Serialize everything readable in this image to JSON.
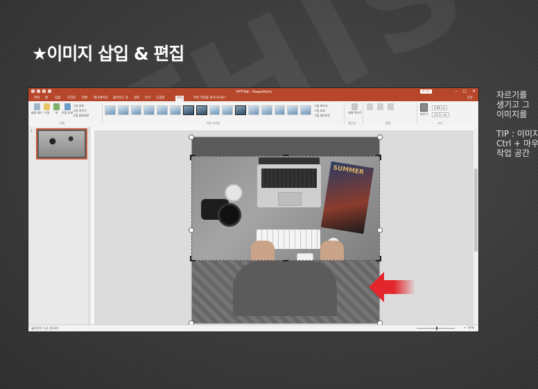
{
  "slide": {
    "title": "★이미지 삽입 & 편집",
    "watermark": "THIS",
    "side_text": {
      "line1": "자르기를 ",
      "line2": "생기고 그",
      "line3": "이미지를 ",
      "tip1": "TIP : 이미지",
      "tip2": "Ctrl + 마우",
      "tip3": "작업 공간"
    }
  },
  "ppt": {
    "doc_title": "PPT자료 - PowerPoint",
    "account_button": "로그인",
    "tabs": [
      "파일",
      "홈",
      "삽입",
      "디자인",
      "전환",
      "애니메이션",
      "슬라이드 쇼",
      "검토",
      "보기",
      "도움말",
      "서식"
    ],
    "active_tab": "서식",
    "tell_me": "어떤 작업을 원하시나요?",
    "share": "공유",
    "ribbon": {
      "remove_bg": "배경 제거",
      "corrections": "수정",
      "color": "색",
      "artistic": "꾸밈 효과",
      "compress": "그림 압축",
      "change": "그림 바꾸기",
      "reset": "그림 원래대로",
      "adjust_group": "조정",
      "styles_group": "그림 스타일",
      "border": "그림 테두리",
      "effects": "그림 효과",
      "layout": "그림 레이아웃",
      "alt_text": "대체 텍스트",
      "access_group": "접근성",
      "arrange_group": "정렬",
      "size_group": "크기",
      "crop": "자르기",
      "height_value": "9.86 cm",
      "width_value": "14.11 cm"
    },
    "slide_number": "1",
    "status_left": "슬라이드 1/1   한국어",
    "status_right": "+ 74%",
    "photo_mag_text": "SUMMER"
  }
}
